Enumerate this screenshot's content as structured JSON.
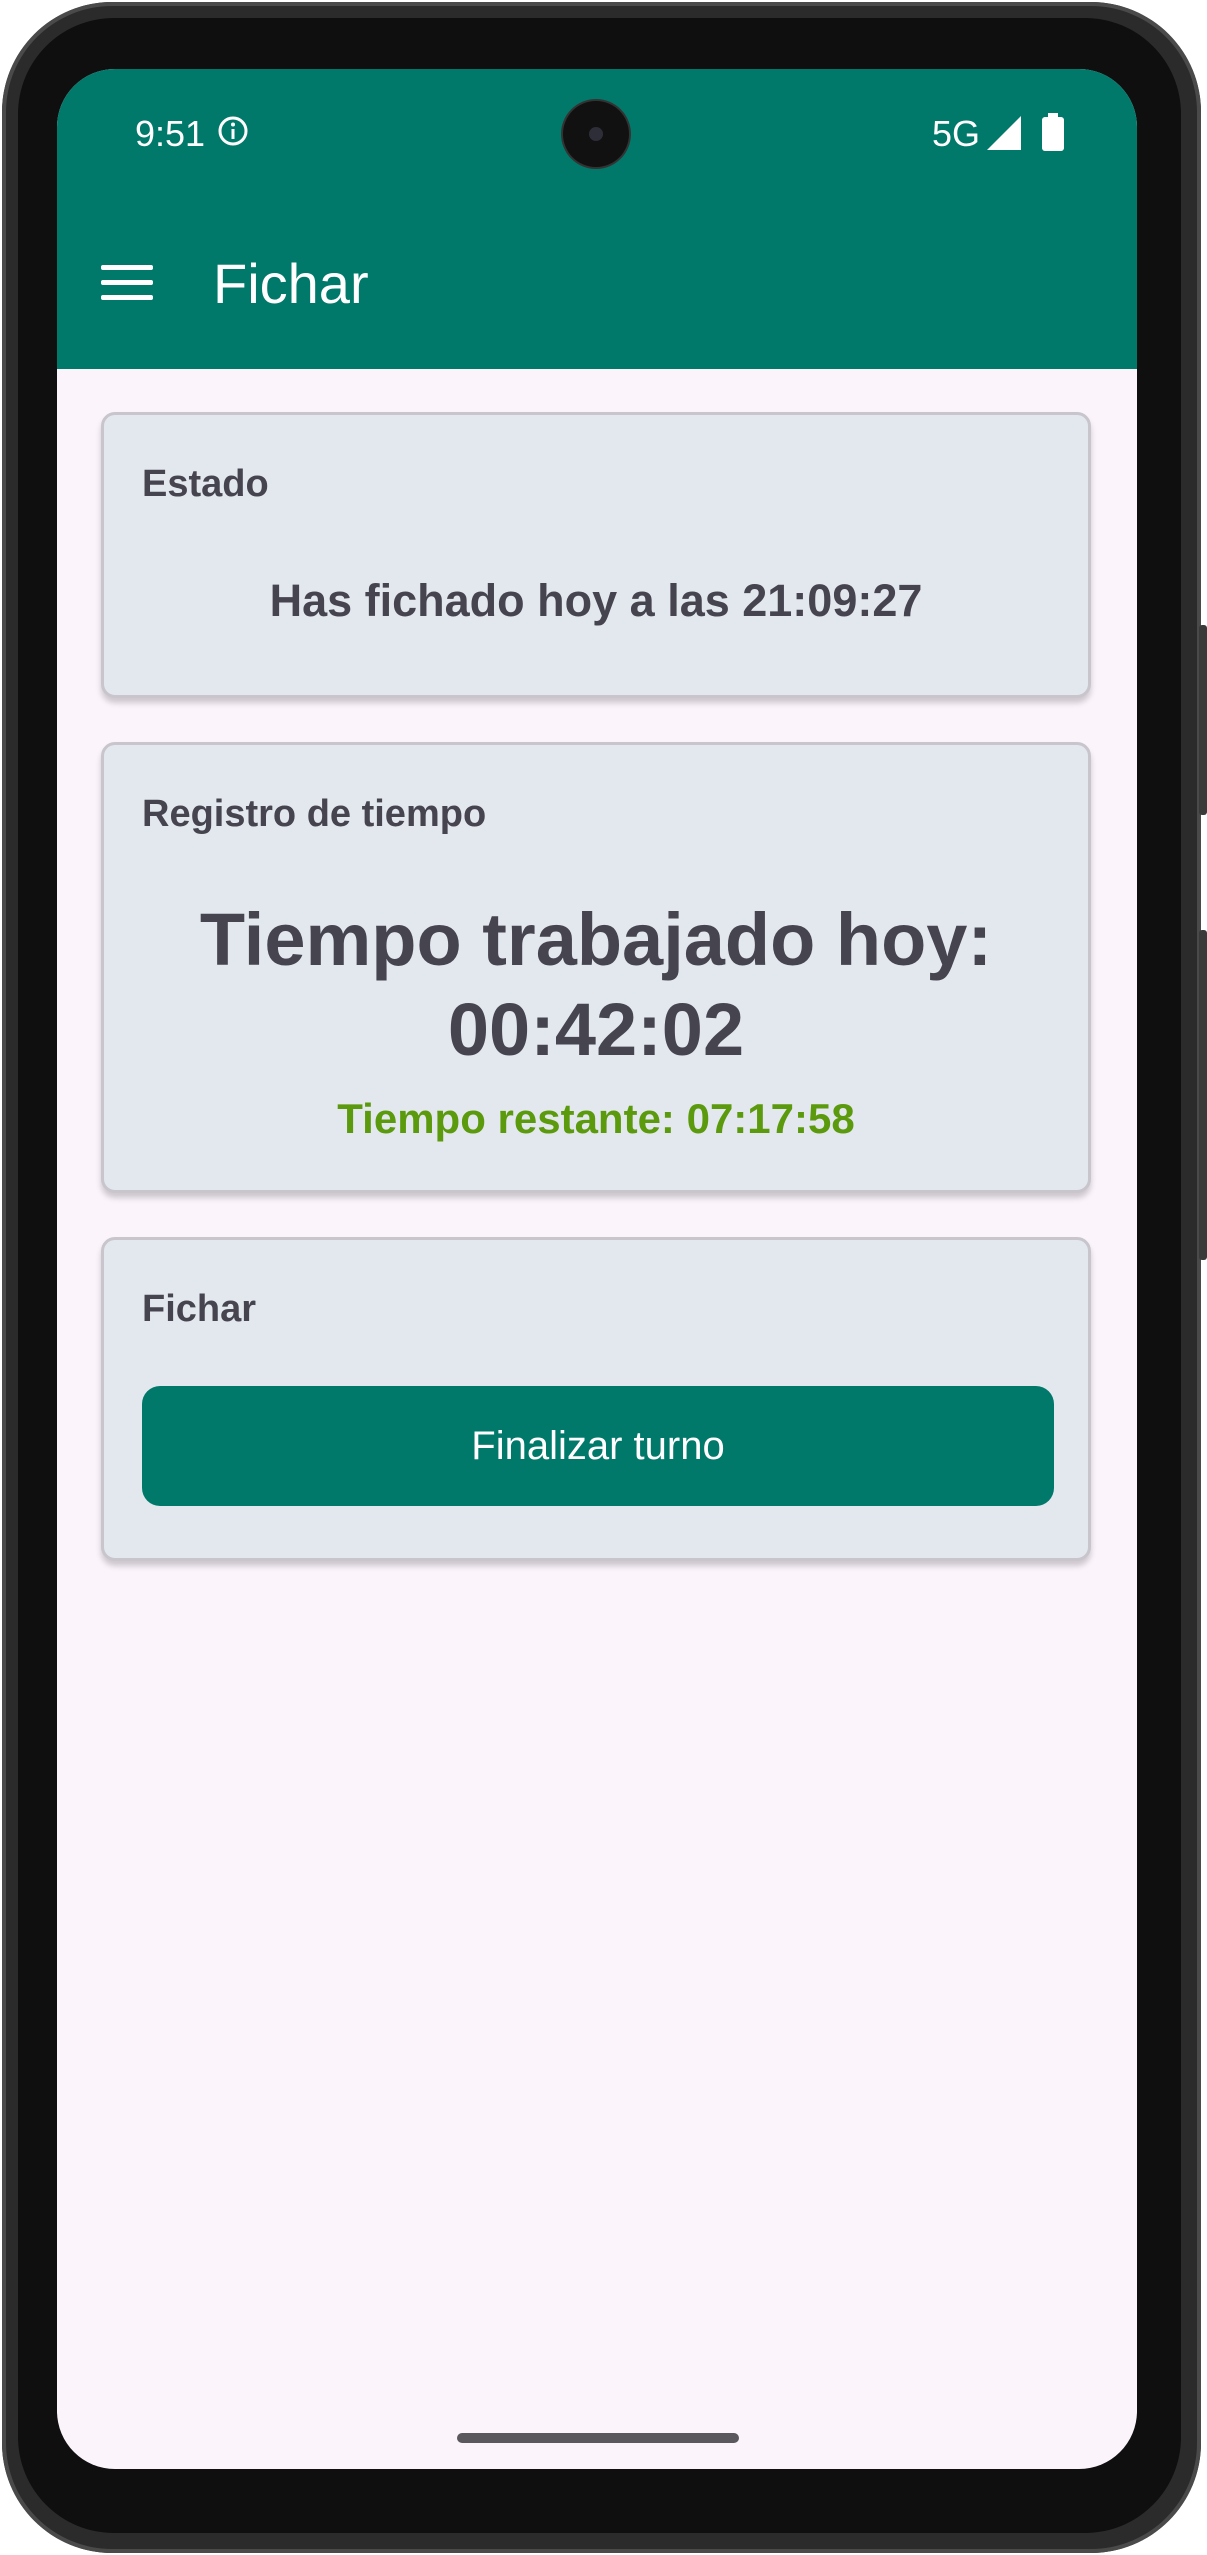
{
  "status_bar": {
    "time": "9:51",
    "network": "5G",
    "icons": [
      "info-icon",
      "signal-icon",
      "battery-icon"
    ]
  },
  "app_bar": {
    "title": "Fichar",
    "menu_icon": "menu-icon"
  },
  "cards": {
    "status": {
      "title": "Estado",
      "message": "Has fichado hoy a las 21:09:27"
    },
    "time_log": {
      "title": "Registro de tiempo",
      "worked_line1": "Tiempo trabajado hoy:",
      "worked_line2": "00:42:02",
      "remaining": "Tiempo restante: 07:17:58"
    },
    "clock": {
      "title": "Fichar",
      "button_label": "Finalizar turno"
    }
  },
  "colors": {
    "primary": "#00796b",
    "background": "#fbf4fb",
    "card": "#e3e8ef",
    "remaining_text": "#5c9a0d",
    "text": "#46444f"
  }
}
